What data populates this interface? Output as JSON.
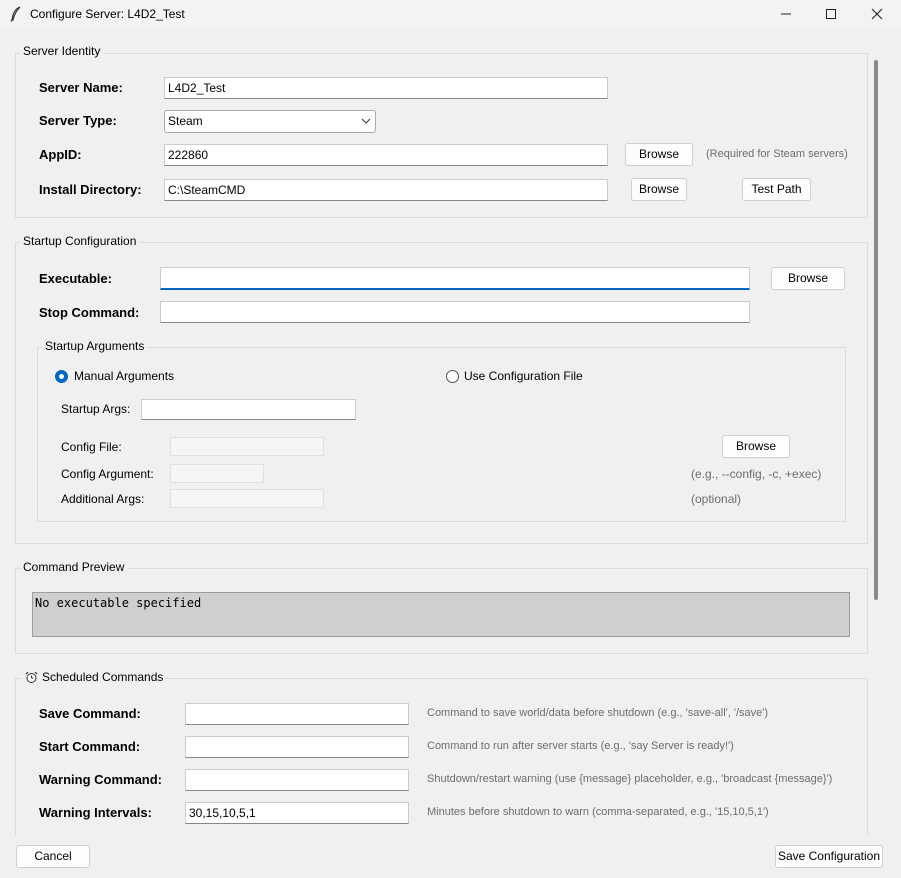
{
  "window": {
    "title": "Configure Server: L4D2_Test",
    "minimize_glyph": "—",
    "maximize_glyph": "☐",
    "close_glyph": "✕",
    "icon": "feather-icon"
  },
  "identity": {
    "title": "Server Identity",
    "name_label": "Server Name:",
    "name_value": "L4D2_Test",
    "type_label": "Server Type:",
    "type_value": "Steam",
    "appid_label": "AppID:",
    "appid_value": "222860",
    "appid_browse": "Browse",
    "appid_hint": "(Required for Steam servers)",
    "dir_label": "Install Directory:",
    "dir_value": "C:\\SteamCMD",
    "dir_browse": "Browse",
    "test_path": "Test Path"
  },
  "startup": {
    "title": "Startup Configuration",
    "exe_label": "Executable:",
    "exe_value": "",
    "exe_browse": "Browse",
    "stop_label": "Stop Command:",
    "stop_value": "",
    "args_group_title": "Startup Arguments",
    "radio_manual": "Manual Arguments",
    "radio_config": "Use Configuration File",
    "selected_mode": "manual",
    "startup_args_label": "Startup Args:",
    "startup_args_value": "",
    "config_file_label": "Config File:",
    "config_file_browse": "Browse",
    "config_arg_label": "Config Argument:",
    "config_arg_hint": "(e.g., --config, -c, +exec)",
    "additional_label": "Additional Args:",
    "additional_hint": "(optional)"
  },
  "preview": {
    "title": "Command Preview",
    "text": "No executable specified"
  },
  "scheduled": {
    "title": "Scheduled Commands",
    "icon": "alarm-clock-icon",
    "rows": [
      {
        "label": "Save Command:",
        "value": "",
        "hint": "Command to save world/data before shutdown (e.g., 'save-all', '/save')"
      },
      {
        "label": "Start Command:",
        "value": "",
        "hint": "Command to run after server starts (e.g., 'say Server is ready!')"
      },
      {
        "label": "Warning Command:",
        "value": "",
        "hint": "Shutdown/restart warning (use {message} placeholder, e.g., 'broadcast {message}')"
      },
      {
        "label": "Warning Intervals:",
        "value": "30,15,10,5,1",
        "hint": "Minutes before shutdown to warn (comma-separated, e.g., '15,10,5,1')"
      }
    ]
  },
  "footer": {
    "cancel": "Cancel",
    "save": "Save Configuration"
  },
  "colors": {
    "accent": "#0067c0",
    "window_bg": "#f0f0f0",
    "hint_text": "#6d6d6d"
  }
}
